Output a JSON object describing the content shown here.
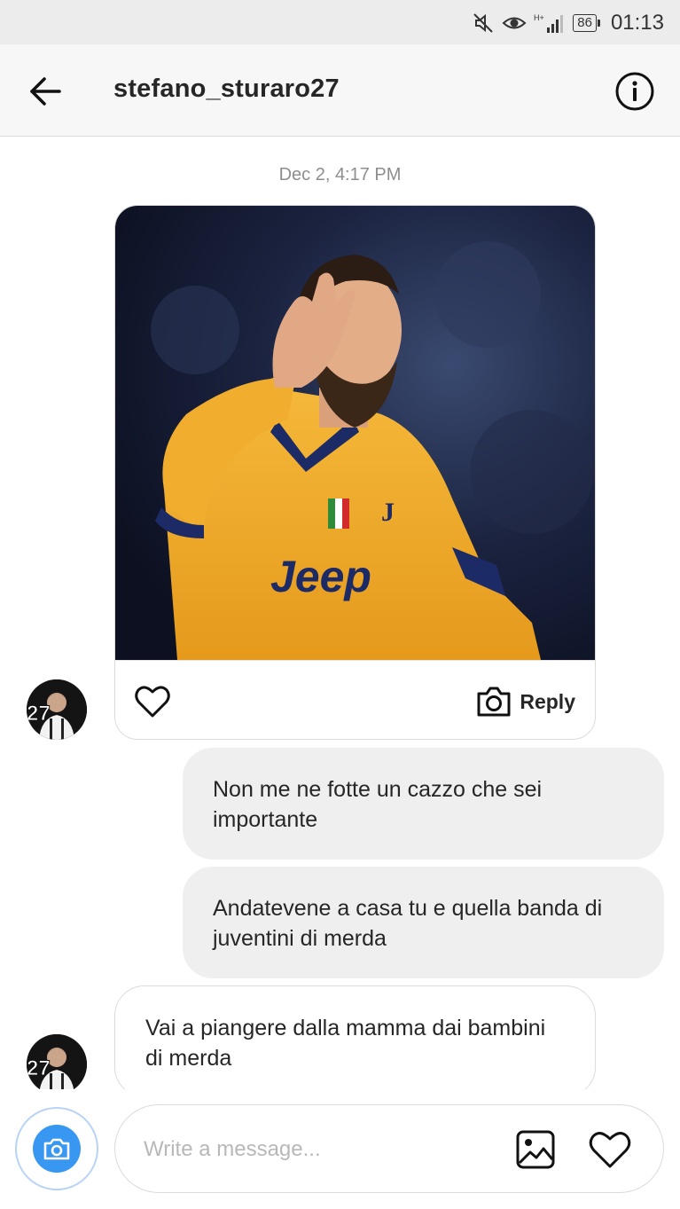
{
  "status_bar": {
    "network": "H+",
    "battery": "86",
    "time": "01:13",
    "icons": [
      "mute-icon",
      "eye-icon",
      "signal-icon",
      "battery-icon"
    ]
  },
  "header": {
    "username": "stefano_sturaro27",
    "back_icon": "back-arrow-icon",
    "info_icon": "info-icon"
  },
  "conversation": {
    "timestamp": "Dec 2, 4:17 PM",
    "shared_post": {
      "jersey_text": "Jeep",
      "actions": {
        "like_icon": "heart-icon",
        "reply_icon": "camera-icon",
        "reply_label": "Reply"
      }
    },
    "messages": [
      {
        "from": "me",
        "text": "Non me ne fotte un cazzo che sei importante"
      },
      {
        "from": "me",
        "text": "Andatevene a casa tu e quella banda di juventini di merda"
      },
      {
        "from": "them",
        "text": "Vai a piangere dalla mamma dai bambini di merda"
      }
    ]
  },
  "composer": {
    "placeholder": "Write a message...",
    "icons": [
      "camera-icon",
      "gallery-icon",
      "heart-icon"
    ]
  },
  "colors": {
    "accent": "#3897f0",
    "bubble_out": "#efefef",
    "border": "#dbdbdb",
    "muted_text": "#8e8e8e"
  }
}
